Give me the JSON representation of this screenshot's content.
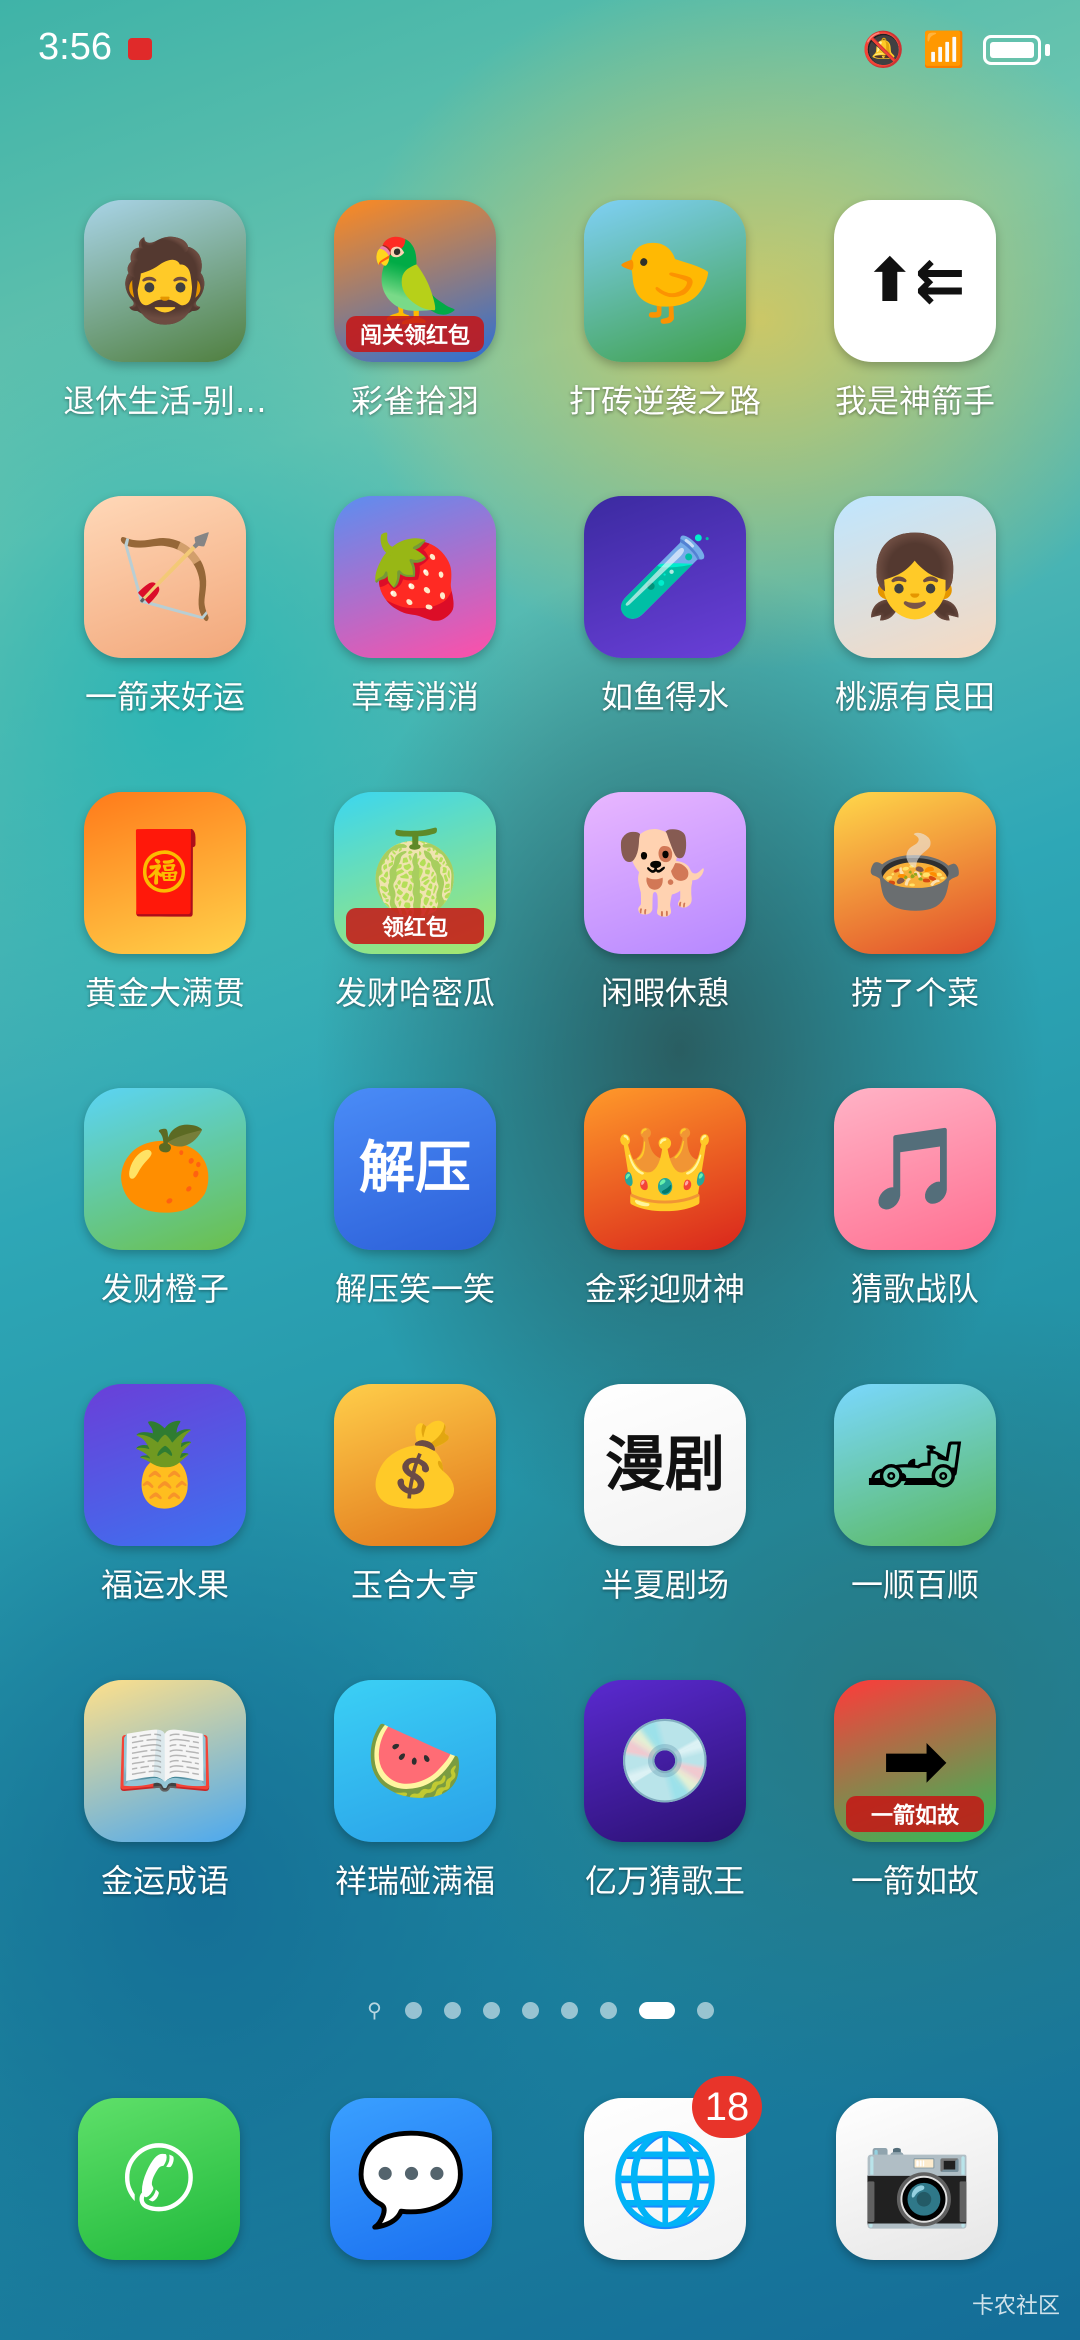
{
  "status_bar": {
    "time": "3:56",
    "icons": [
      "mute-icon",
      "wifi-icon",
      "signal-icon",
      "battery-icon"
    ]
  },
  "apps": [
    {
      "label": "退休生活-别…",
      "icon": "person-car-icon",
      "colors": [
        "#a9d4e8",
        "#4f7f3e"
      ],
      "glyph": "🧔"
    },
    {
      "label": "彩雀拾羽",
      "icon": "parrot-icon",
      "colors": [
        "#ff8a1f",
        "#2b6fd6"
      ],
      "glyph": "🦜",
      "tag": "闯关领红包"
    },
    {
      "label": "打砖逆袭之路",
      "icon": "yellow-ball-icon",
      "colors": [
        "#7fd0f5",
        "#3fa04a"
      ],
      "glyph": "🐤"
    },
    {
      "label": "我是神箭手",
      "icon": "arrows-icon",
      "colors": [
        "#ffffff",
        "#ffffff"
      ],
      "glyph": "⬆⇇",
      "dark": true
    },
    {
      "label": "一箭来好运",
      "icon": "red-arrow-icon",
      "colors": [
        "#ffd8b8",
        "#f2a77a"
      ],
      "glyph": "🏹"
    },
    {
      "label": "草莓消消",
      "icon": "candy-icon",
      "colors": [
        "#5b8ef0",
        "#ff4fa8"
      ],
      "glyph": "🍓"
    },
    {
      "label": "如鱼得水",
      "icon": "test-tubes-icon",
      "colors": [
        "#3b2aa0",
        "#6a3fd8"
      ],
      "glyph": "🧪"
    },
    {
      "label": "桃源有良田",
      "icon": "girl-icon",
      "colors": [
        "#bfe6ff",
        "#f7d9c0"
      ],
      "glyph": "👧"
    },
    {
      "label": "黄金大满贯",
      "icon": "god-of-wealth-icon",
      "colors": [
        "#ff7a1a",
        "#ffd24a"
      ],
      "glyph": "🧧"
    },
    {
      "label": "发财哈密瓜",
      "icon": "melon-icon",
      "colors": [
        "#3bd6f0",
        "#a8e86a"
      ],
      "glyph": "🍈",
      "tag": "领红包"
    },
    {
      "label": "闲暇休憩",
      "icon": "shiba-dog-icon",
      "colors": [
        "#e9b7ff",
        "#b688ff"
      ],
      "glyph": "🐕"
    },
    {
      "label": "捞了个菜",
      "icon": "hotpot-icon",
      "colors": [
        "#ffd84a",
        "#e14a2a"
      ],
      "glyph": "🍲"
    },
    {
      "label": "发财橙子",
      "icon": "orange-icon",
      "colors": [
        "#5bd4f5",
        "#6bbf4a"
      ],
      "glyph": "🍊"
    },
    {
      "label": "解压笑一笑",
      "icon": "laugh-text-icon",
      "colors": [
        "#4a8cf7",
        "#2c5fd8"
      ],
      "glyph": "解压"
    },
    {
      "label": "金彩迎财神",
      "icon": "wealth-god-gold-icon",
      "colors": [
        "#ff9a2a",
        "#d9261c"
      ],
      "glyph": "👑"
    },
    {
      "label": "猜歌战队",
      "icon": "music-flower-icon",
      "colors": [
        "#ffb3c6",
        "#ff6f91"
      ],
      "glyph": "🎵"
    },
    {
      "label": "福运水果",
      "icon": "fruits-icon",
      "colors": [
        "#6a3fd8",
        "#3d72f0"
      ],
      "glyph": "🍍"
    },
    {
      "label": "玉合大亨",
      "icon": "rich-man-icon",
      "colors": [
        "#ffce4a",
        "#e0741a"
      ],
      "glyph": "💰"
    },
    {
      "label": "半夏剧场",
      "icon": "comic-drama-icon",
      "colors": [
        "#ffffff",
        "#f2f2f2"
      ],
      "glyph": "漫剧",
      "dark": true
    },
    {
      "label": "一顺百顺",
      "icon": "red-car-icon",
      "colors": [
        "#7ad8ff",
        "#5ab85a"
      ],
      "glyph": "🏎"
    },
    {
      "label": "金运成语",
      "icon": "scholar-boy-icon",
      "colors": [
        "#ffe08a",
        "#4aa8f0"
      ],
      "glyph": "📖"
    },
    {
      "label": "祥瑞碰满福",
      "icon": "watermelon-persimmon-icon",
      "colors": [
        "#3bd0f5",
        "#2aa0e8"
      ],
      "glyph": "🍉"
    },
    {
      "label": "亿万猜歌王",
      "icon": "music-disc-icon",
      "colors": [
        "#5a2ad0",
        "#2a1070"
      ],
      "glyph": "💿"
    },
    {
      "label": "一箭如故",
      "icon": "green-arrow-icon",
      "colors": [
        "#ff3a3a",
        "#2ac05a"
      ],
      "glyph": "➡",
      "tag": "一箭如故"
    }
  ],
  "page_indicator": {
    "count": 8,
    "active_index": 6
  },
  "dock": [
    {
      "name": "phone",
      "icon": "phone-icon",
      "colors": [
        "#5fe06a",
        "#1fb83a"
      ],
      "glyph": "✆"
    },
    {
      "name": "messages",
      "icon": "message-bubble-icon",
      "colors": [
        "#3aa0ff",
        "#1a6ff0"
      ],
      "glyph": "💬"
    },
    {
      "name": "browser",
      "icon": "globe-icon",
      "colors": [
        "#ffffff",
        "#f2f2f2"
      ],
      "glyph": "🌐",
      "badge": "18"
    },
    {
      "name": "camera",
      "icon": "camera-icon",
      "colors": [
        "#ffffff",
        "#e6e6e6"
      ],
      "glyph": "📷"
    }
  ],
  "watermark": "卡农社区"
}
